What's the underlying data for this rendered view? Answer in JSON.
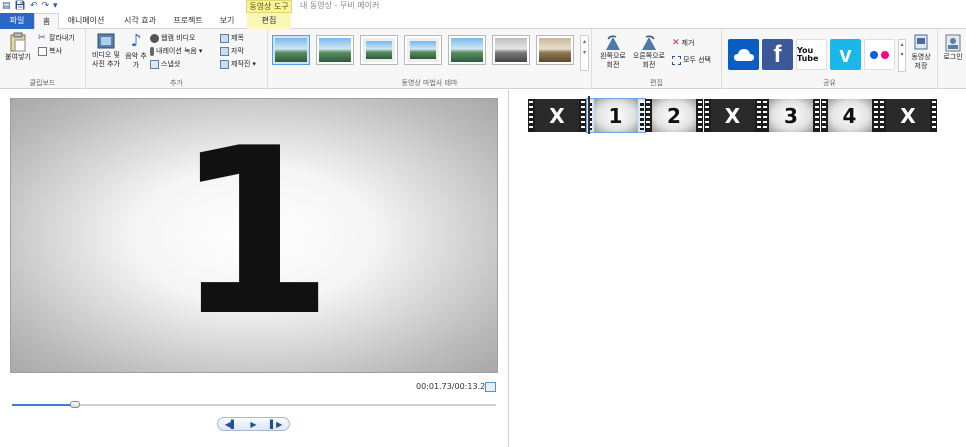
{
  "titlebar": {
    "context_tab": "동영상 도구",
    "window_title": "내 동영상 - 무비 메이커",
    "qa_icons": [
      "app-icon",
      "save-icon",
      "undo-icon",
      "redo-icon",
      "customize-icon"
    ]
  },
  "tabs": [
    {
      "label": "파일"
    },
    {
      "label": "홈"
    },
    {
      "label": "애니메이션"
    },
    {
      "label": "시각 효과"
    },
    {
      "label": "프로젝트"
    },
    {
      "label": "보기"
    },
    {
      "label": "편집"
    }
  ],
  "clipboard": {
    "paste": "붙여넣기",
    "cut": "잘라내기",
    "copy": "복사",
    "label": "클립보드"
  },
  "add": {
    "add_media": "비디오 및 사진 추가",
    "add_music": "음악 추가",
    "webcam": "웹캠 비디오",
    "narration": "내레이션 녹음",
    "snapshot": "스냅샷",
    "title": "제목",
    "caption": "자막",
    "credits": "제작진",
    "label": "추가"
  },
  "themes": {
    "label": "동영상 마법사 테마",
    "count": 7
  },
  "editing": {
    "rotate_left": "왼쪽으로 회전",
    "rotate_right": "오른쪽으로 회전",
    "remove": "제거",
    "select_all": "모두 선택",
    "label": "편집"
  },
  "share": {
    "services": [
      "onedrive-icon",
      "facebook-icon",
      "youtube-icon",
      "vimeo-icon",
      "flickr-icon"
    ],
    "youtube_text": "You Tube",
    "save_movie": "동영상 저장",
    "signin": "로그인",
    "label": "공유"
  },
  "preview": {
    "frame_text": "1",
    "time": "00:01.73/00:13.20",
    "progress": 0.131
  },
  "storyboard": {
    "clips": [
      {
        "text": "X",
        "style": "dark"
      },
      {
        "text": "1",
        "style": "light",
        "selected": true
      },
      {
        "text": "2",
        "style": "light"
      },
      {
        "text": "X",
        "style": "dark"
      },
      {
        "text": "3",
        "style": "light"
      },
      {
        "text": "4",
        "style": "light"
      },
      {
        "text": "X",
        "style": "dark"
      }
    ]
  }
}
